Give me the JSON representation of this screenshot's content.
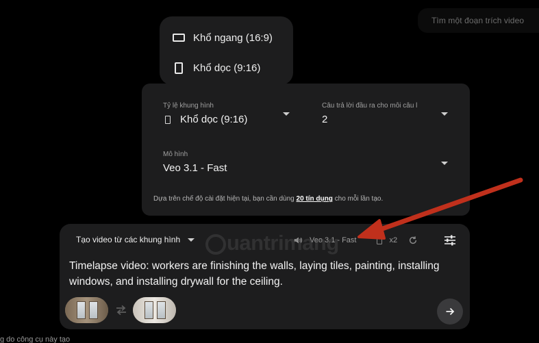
{
  "search": {
    "hint": "Tìm một đoạn trích video"
  },
  "aspect_menu": {
    "items": [
      {
        "label": "Khổ ngang (16:9)",
        "icon": "landscape-rect-icon"
      },
      {
        "label": "Khổ dọc (9:16)",
        "icon": "portrait-rect-icon"
      }
    ]
  },
  "settings": {
    "aspect_label": "Tỷ lệ khung hình",
    "aspect_value": "Khổ dọc (9:16)",
    "outputs_label": "Câu trả lời đầu ra cho mỗi câu l",
    "outputs_value": "2",
    "model_label": "Mô hình",
    "model_value": "Veo 3.1 - Fast",
    "note_prefix": "Dựa trên chế độ cài đặt hiện tại, bạn cần dùng ",
    "note_credits": "20 tín dụng",
    "note_suffix": " cho mỗi lần tạo."
  },
  "composer": {
    "mode_label": "Tạo video từ các khung hình",
    "model_chip": "Veo 3.1 - Fast",
    "count": "x2",
    "prompt": "Timelapse video: workers are finishing the walls, laying tiles, painting, installing windows, and installing drywall for the ceiling."
  },
  "watermark": "uantrimang",
  "footer": "g do công cụ này tạo",
  "colors": {
    "background": "#000000",
    "panel": "#1d1d1e",
    "annotation_arrow": "#c0301c"
  }
}
